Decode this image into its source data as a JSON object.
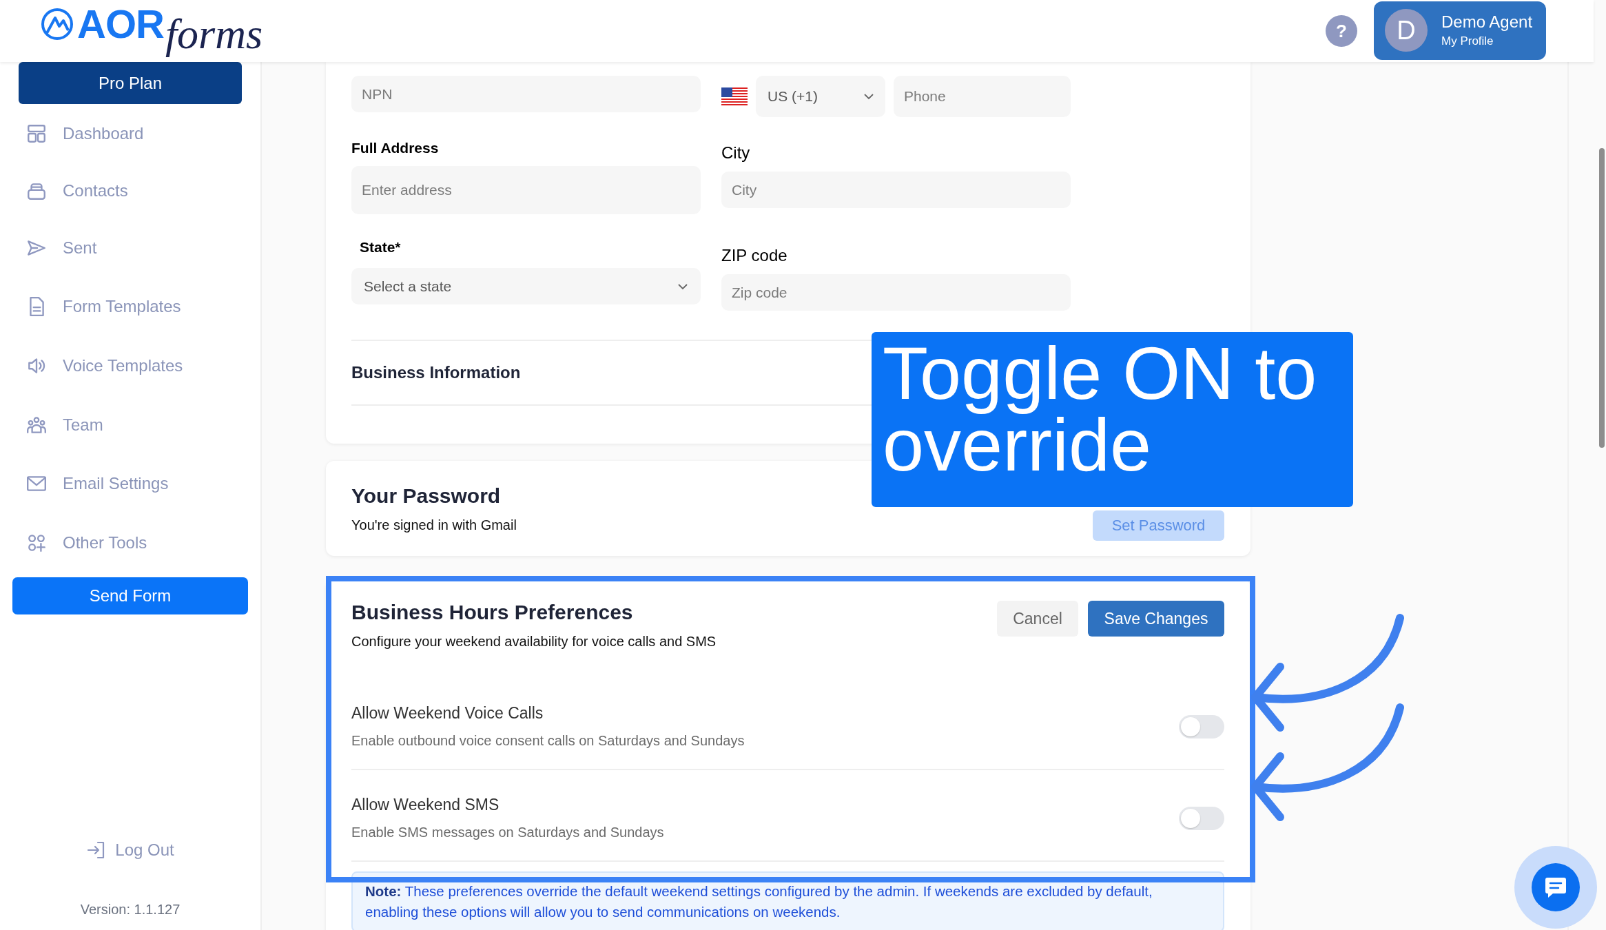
{
  "header": {
    "logo_primary": "AOR",
    "logo_script": "forms",
    "help": "?",
    "profile": {
      "initial": "D",
      "name": "Demo Agent",
      "link": "My Profile"
    }
  },
  "sidebar": {
    "plan_button": "Pro Plan",
    "items": [
      {
        "label": "Dashboard",
        "kind": "dashboard"
      },
      {
        "label": "Contacts",
        "kind": "contacts"
      },
      {
        "label": "Sent",
        "kind": "sent"
      },
      {
        "label": "Form Templates",
        "kind": "document"
      },
      {
        "label": "Voice Templates",
        "kind": "speaker"
      },
      {
        "label": "Team",
        "kind": "team"
      },
      {
        "label": "Email Settings",
        "kind": "mail"
      },
      {
        "label": "Other Tools",
        "kind": "tools"
      }
    ],
    "send_button": "Send Form",
    "logout": "Log Out",
    "version": "Version: 1.1.127"
  },
  "profile_form": {
    "npn": {
      "placeholder": "NPN"
    },
    "country_code": {
      "value": "US (+1)"
    },
    "phone": {
      "placeholder": "Phone"
    },
    "address": {
      "label": "Full Address",
      "placeholder": "Enter address"
    },
    "city": {
      "label": "City",
      "placeholder": "City"
    },
    "state": {
      "label": "State*",
      "placeholder": "Select a state"
    },
    "zip": {
      "label": "ZIP code",
      "placeholder": "Zip code"
    },
    "section": "Business Information"
  },
  "password": {
    "title": "Your Password",
    "subtitle": "You're signed in with Gmail",
    "button": "Set Password"
  },
  "business_hours": {
    "title": "Business Hours Preferences",
    "subtitle": "Configure your weekend availability for voice calls and SMS",
    "cancel": "Cancel",
    "save": "Save Changes",
    "options": [
      {
        "title": "Allow Weekend Voice Calls",
        "description": "Enable outbound voice consent calls on Saturdays and Sundays",
        "on": false
      },
      {
        "title": "Allow Weekend SMS",
        "description": "Enable SMS messages on Saturdays and Sundays",
        "on": false
      }
    ],
    "note": "**Note:** These preferences override the default weekend settings configured by the admin. If weekends are excluded by default, enabling these options will allow you to send communications on weekends."
  },
  "annotation": {
    "callout": "Toggle ON to override"
  }
}
